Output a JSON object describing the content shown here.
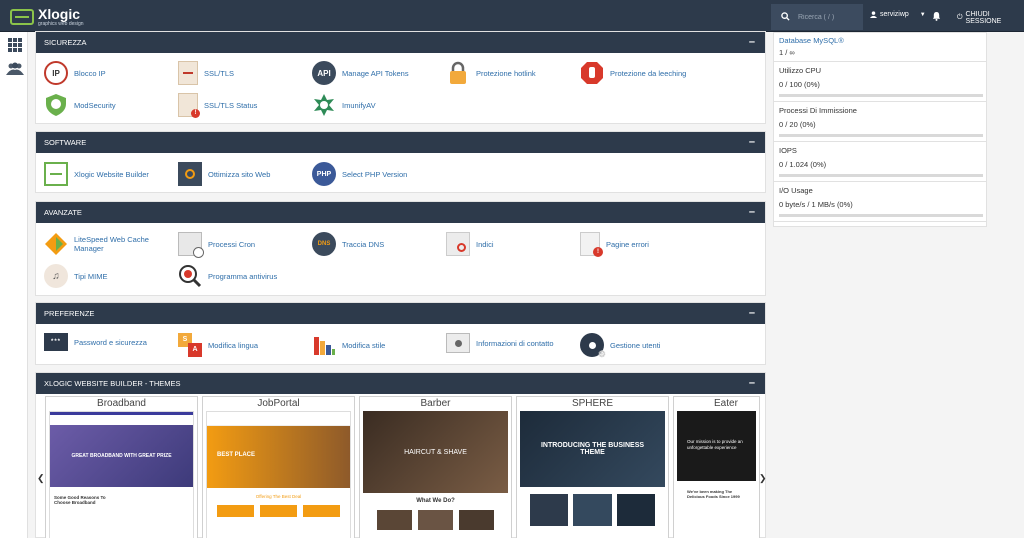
{
  "header": {
    "logo_name": "Xlogic",
    "logo_tagline": "graphics web design",
    "search_placeholder": "Ricerca ( / )",
    "user": "serviziwp",
    "logout": "CHIUDI SESSIONE"
  },
  "sidebar": {
    "icons": [
      "grid-icon",
      "users-icon"
    ]
  },
  "panels": {
    "sicurezza": {
      "title": "SICUREZZA",
      "items": [
        "Blocco IP",
        "SSL/TLS",
        "Manage API Tokens",
        "Protezione hotlink",
        "Protezione da leeching",
        "ModSecurity",
        "SSL/TLS Status",
        "ImunifyAV"
      ]
    },
    "software": {
      "title": "SOFTWARE",
      "items": [
        "Xlogic Website Builder",
        "Ottimizza sito Web",
        "Select PHP Version"
      ]
    },
    "avanzate": {
      "title": "AVANZATE",
      "items": [
        "LiteSpeed Web Cache Manager",
        "Processi Cron",
        "Traccia DNS",
        "Indici",
        "Pagine errori",
        "Tipi MIME",
        "Programma antivirus"
      ]
    },
    "preferenze": {
      "title": "PREFERENZE",
      "items": [
        "Password e sicurezza",
        "Modifica lingua",
        "Modifica stile",
        "Informazioni di contatto",
        "Gestione utenti"
      ]
    }
  },
  "stats": [
    {
      "label": "Database MySQL®",
      "value": "1 / ∞"
    },
    {
      "label": "Utilizzo CPU",
      "value": "0 / 100   (0%)",
      "fill": 0
    },
    {
      "label": "Processi Di Immissione",
      "value": "0 / 20   (0%)",
      "fill": 0
    },
    {
      "label": "IOPS",
      "value": "0 / 1.024   (0%)",
      "fill": 0
    },
    {
      "label": "I/O Usage",
      "value": "0 byte/s / 1 MB/s   (0%)",
      "fill": 0
    }
  ],
  "themes": {
    "title": "XLOGIC WEBSITE BUILDER - THEMES",
    "cards": [
      {
        "name": "Broadband",
        "hero": "GREAT BROADBAND WITH GREAT PRIZE",
        "sub": "Some Good Reasons To Choose Broadband"
      },
      {
        "name": "JobPortal",
        "hero": "BEST PLACE",
        "sub": "Offering The Best Deal"
      },
      {
        "name": "Barber",
        "hero": "HAIRCUT & SHAVE",
        "sub": "What We Do?"
      },
      {
        "name": "SPHERE",
        "hero": "INTRODUCING THE BUSINESS THEME",
        "sub": ""
      },
      {
        "name": "Eater",
        "hero": "Our mission is to provide an unforgettable experience",
        "sub": "We've been making The Delicious Foods Since 1999"
      }
    ]
  },
  "colors": {
    "header": "#2d3a4b",
    "link": "#2f6ea9"
  }
}
